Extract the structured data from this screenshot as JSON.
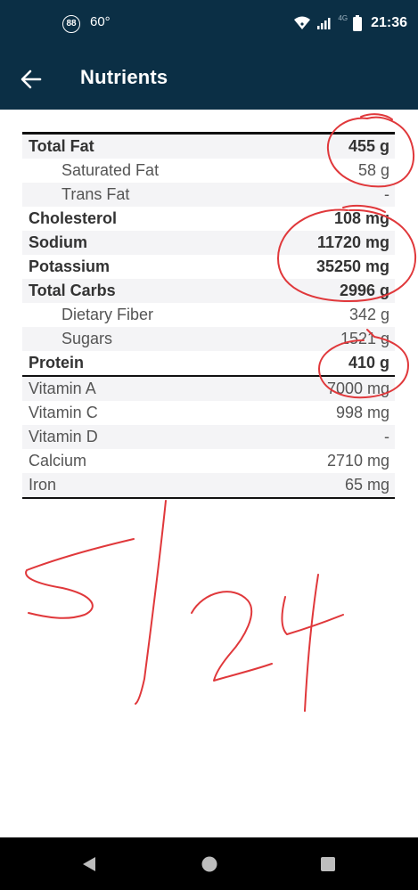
{
  "status_bar": {
    "notification_badge": "88",
    "temperature": "60°",
    "network": "4G",
    "time": "21:36",
    "icons": [
      "notification-badge-icon",
      "wifi-icon",
      "signal-icon",
      "battery-icon"
    ]
  },
  "app_bar": {
    "title": "Nutrients",
    "back_icon": "arrow-left-icon"
  },
  "nutrients": [
    {
      "label": "Total Fat",
      "value": "455 g"
    },
    {
      "label": "Saturated Fat",
      "value": "58 g"
    },
    {
      "label": "Trans Fat",
      "value": "-"
    },
    {
      "label": "Cholesterol",
      "value": "108 mg"
    },
    {
      "label": "Sodium",
      "value": "11720 mg"
    },
    {
      "label": "Potassium",
      "value": "35250 mg"
    },
    {
      "label": "Total Carbs",
      "value": "2996 g"
    },
    {
      "label": "Dietary Fiber",
      "value": "342 g"
    },
    {
      "label": "Sugars",
      "value": "1521 g"
    },
    {
      "label": "Protein",
      "value": "410 g"
    }
  ],
  "vitamins": [
    {
      "label": "Vitamin A",
      "value": "7000 mg"
    },
    {
      "label": "Vitamin C",
      "value": "998 mg"
    },
    {
      "label": "Vitamin D",
      "value": "-"
    },
    {
      "label": "Calcium",
      "value": "2710 mg"
    },
    {
      "label": "Iron",
      "value": "65 mg"
    }
  ],
  "handwriting": {
    "text": "5/24",
    "ink_color": "#e0383b"
  },
  "nav_bar": {
    "icons": [
      "back-triangle-icon",
      "home-circle-icon",
      "recents-square-icon"
    ]
  }
}
